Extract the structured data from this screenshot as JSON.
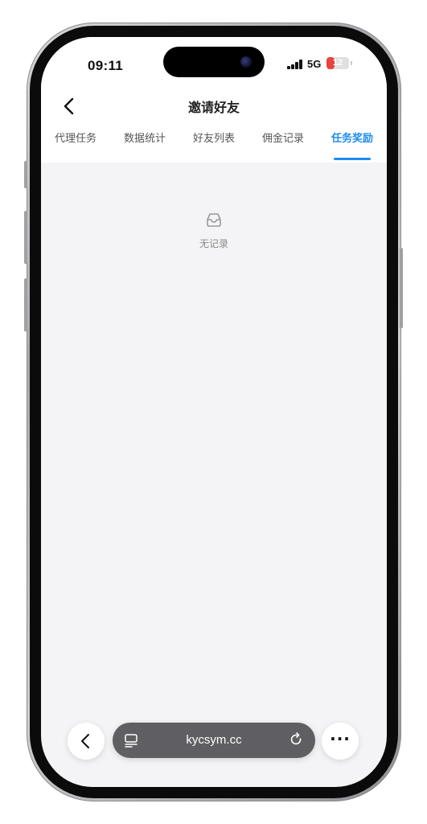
{
  "status_bar": {
    "time": "09:11",
    "network": "5G",
    "battery_percent": "12",
    "battery_level": 0.12,
    "battery_color": "#e6463e",
    "signal_bars": 4
  },
  "header": {
    "title": "邀请好友",
    "back_icon": "chevron-left-icon"
  },
  "tabs": [
    {
      "label": "代理任务",
      "active": false
    },
    {
      "label": "数据统计",
      "active": false
    },
    {
      "label": "好友列表",
      "active": false
    },
    {
      "label": "佣金记录",
      "active": false
    },
    {
      "label": "任务奖励",
      "active": true
    }
  ],
  "empty_state": {
    "icon": "inbox-icon",
    "text": "无记录"
  },
  "browser": {
    "url": "kycsym.cc",
    "back_icon": "chevron-left-icon",
    "tabs_icon": "tabs-icon",
    "reload_icon": "reload-icon",
    "more_label": "···"
  },
  "colors": {
    "accent": "#1f8df0",
    "page_background": "#f4f4f6",
    "url_bar": "#5f5f63"
  }
}
